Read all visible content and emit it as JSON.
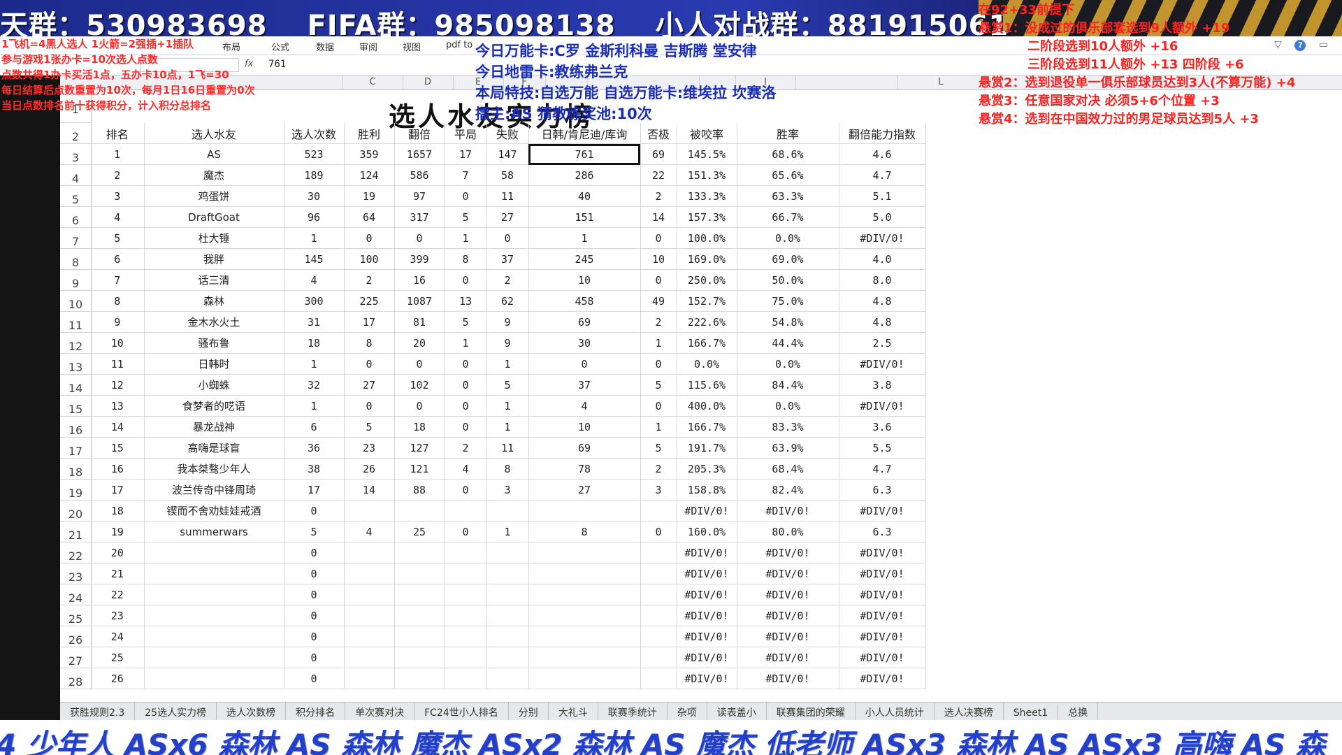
{
  "banner": {
    "segments": [
      "天群：530983698",
      "FIFA群：985098138",
      "小人对战群：881915061"
    ]
  },
  "ribbon": {
    "tabs": [
      "布局",
      "公式",
      "数据",
      "审阅",
      "视图",
      "pdf to"
    ]
  },
  "formula_bar": {
    "fx": "fx",
    "value": "761"
  },
  "sheet": {
    "columns": [
      "C",
      "D",
      "E",
      "F",
      "I",
      "L"
    ],
    "title": "选人水友实力榜",
    "headers": [
      "排名",
      "选人水友",
      "选人次数",
      "胜利",
      "翻倍",
      "平局",
      "失败",
      "日韩/肯尼迪/库询",
      "否极",
      "被咬率",
      "胜率",
      "翻倍能力指数"
    ],
    "row_numbers": [
      "1",
      "2",
      "3",
      "4",
      "5",
      "6",
      "7",
      "8",
      "9",
      "10",
      "11",
      "12",
      "13",
      "14",
      "15",
      "16",
      "17",
      "18",
      "19",
      "20",
      "21",
      "22",
      "23",
      "24",
      "25",
      "26",
      "27",
      "28"
    ],
    "rows": [
      [
        "1",
        "AS",
        "523",
        "359",
        "1657",
        "17",
        "147",
        "761",
        "69",
        "145.5%",
        "68.6%",
        "4.6"
      ],
      [
        "2",
        "魔杰",
        "189",
        "124",
        "586",
        "7",
        "58",
        "286",
        "22",
        "151.3%",
        "65.6%",
        "4.7"
      ],
      [
        "3",
        "鸡蛋饼",
        "30",
        "19",
        "97",
        "0",
        "11",
        "40",
        "2",
        "133.3%",
        "63.3%",
        "5.1"
      ],
      [
        "4",
        "DraftGoat",
        "96",
        "64",
        "317",
        "5",
        "27",
        "151",
        "14",
        "157.3%",
        "66.7%",
        "5.0"
      ],
      [
        "5",
        "杜大锤",
        "1",
        "0",
        "0",
        "1",
        "0",
        "1",
        "0",
        "100.0%",
        "0.0%",
        "#DIV/0!"
      ],
      [
        "6",
        "我胖",
        "145",
        "100",
        "399",
        "8",
        "37",
        "245",
        "10",
        "169.0%",
        "69.0%",
        "4.0"
      ],
      [
        "7",
        "话三清",
        "4",
        "2",
        "16",
        "0",
        "2",
        "10",
        "0",
        "250.0%",
        "50.0%",
        "8.0"
      ],
      [
        "8",
        "森林",
        "300",
        "225",
        "1087",
        "13",
        "62",
        "458",
        "49",
        "152.7%",
        "75.0%",
        "4.8"
      ],
      [
        "9",
        "金木水火土",
        "31",
        "17",
        "81",
        "5",
        "9",
        "69",
        "2",
        "222.6%",
        "54.8%",
        "4.8"
      ],
      [
        "10",
        "骚布鲁",
        "18",
        "8",
        "20",
        "1",
        "9",
        "30",
        "1",
        "166.7%",
        "44.4%",
        "2.5"
      ],
      [
        "11",
        "日韩时",
        "1",
        "0",
        "0",
        "0",
        "1",
        "0",
        "0",
        "0.0%",
        "0.0%",
        "#DIV/0!"
      ],
      [
        "12",
        "小蜘蛛",
        "32",
        "27",
        "102",
        "0",
        "5",
        "37",
        "5",
        "115.6%",
        "84.4%",
        "3.8"
      ],
      [
        "13",
        "食梦者的呓语",
        "1",
        "0",
        "0",
        "0",
        "1",
        "4",
        "0",
        "400.0%",
        "0.0%",
        "#DIV/0!"
      ],
      [
        "14",
        "暴龙战神",
        "6",
        "5",
        "18",
        "0",
        "1",
        "10",
        "1",
        "166.7%",
        "83.3%",
        "3.6"
      ],
      [
        "15",
        "高嗨是球盲",
        "36",
        "23",
        "127",
        "2",
        "11",
        "69",
        "5",
        "191.7%",
        "63.9%",
        "5.5"
      ],
      [
        "16",
        "我本桀骜少年人",
        "38",
        "26",
        "121",
        "4",
        "8",
        "78",
        "2",
        "205.3%",
        "68.4%",
        "4.7"
      ],
      [
        "17",
        "波兰传奇中锋周琦",
        "17",
        "14",
        "88",
        "0",
        "3",
        "27",
        "3",
        "158.8%",
        "82.4%",
        "6.3"
      ],
      [
        "18",
        "锲而不舍劝娃娃戒酒",
        "0",
        "",
        "",
        "",
        "",
        "",
        "",
        "#DIV/0!",
        "#DIV/0!",
        "#DIV/0!"
      ],
      [
        "19",
        "summerwars",
        "5",
        "4",
        "25",
        "0",
        "1",
        "8",
        "0",
        "160.0%",
        "80.0%",
        "6.3"
      ],
      [
        "20",
        "",
        "0",
        "",
        "",
        "",
        "",
        "",
        "",
        "#DIV/0!",
        "#DIV/0!",
        "#DIV/0!"
      ],
      [
        "21",
        "",
        "0",
        "",
        "",
        "",
        "",
        "",
        "",
        "#DIV/0!",
        "#DIV/0!",
        "#DIV/0!"
      ],
      [
        "22",
        "",
        "0",
        "",
        "",
        "",
        "",
        "",
        "",
        "#DIV/0!",
        "#DIV/0!",
        "#DIV/0!"
      ],
      [
        "23",
        "",
        "0",
        "",
        "",
        "",
        "",
        "",
        "",
        "#DIV/0!",
        "#DIV/0!",
        "#DIV/0!"
      ],
      [
        "24",
        "",
        "0",
        "",
        "",
        "",
        "",
        "",
        "",
        "#DIV/0!",
        "#DIV/0!",
        "#DIV/0!"
      ],
      [
        "25",
        "",
        "0",
        "",
        "",
        "",
        "",
        "",
        "",
        "#DIV/0!",
        "#DIV/0!",
        "#DIV/0!"
      ],
      [
        "26",
        "",
        "0",
        "",
        "",
        "",
        "",
        "",
        "",
        "#DIV/0!",
        "#DIV/0!",
        "#DIV/0!"
      ]
    ],
    "selected_cell": {
      "row": 0,
      "col": 7
    }
  },
  "sheet_tabs": [
    "获胜规则2.3",
    "25选人实力榜",
    "选人次数榜",
    "积分排名",
    "单次赛对决",
    "FC24世小人排名",
    "分别",
    "大礼斗",
    "联赛季统计",
    "杂项",
    "读表盖小",
    "联赛集团的荣耀",
    "小人人员统计",
    "选人决赛榜",
    "Sheet1",
    "总换"
  ],
  "overlays": {
    "left_notes": [
      "1飞机=4黑人选人  1火箭=2强插+1插队",
      "参与游戏1张办卡=10次选人点数",
      "点数共得1办卡买活1点，五办卡10点，1飞=30",
      "每日结算后点数重置为10次，每月1日16日重置为0次",
      "当日点数排名前十获得积分，计入积分总排名"
    ],
    "center_notes": [
      "今日万能卡:C罗 金斯利科曼 吉斯腾 堂安律",
      "今日地雷卡:教练弗兰克",
      "本局特技:自选万能      自选万能卡:维埃拉 坎赛洛",
      "擂主:AS      猜教练奖池:10次"
    ],
    "right_notes": [
      "在92+33前提下",
      "悬赏1：没成过的俱乐部套选到9人额外 +19",
      "二阶段选到10人额外 +16",
      "三阶段选到11人额外 +13  四阶段 +6",
      "悬赏2：选到退役单一俱乐部球员达到3人(不算万能) +4",
      "悬赏3：任意国家对决 必须5+6个位置 +3",
      "悬赏4：选到在中国效力过的男足球员达到5人 +3"
    ]
  },
  "ticker": "4 少年人 ASx6 森林 AS 森林 魔杰 ASx2 森林 AS 魔杰 低老师 ASx3 森林 AS ASx3 高嗨 AS 森"
}
